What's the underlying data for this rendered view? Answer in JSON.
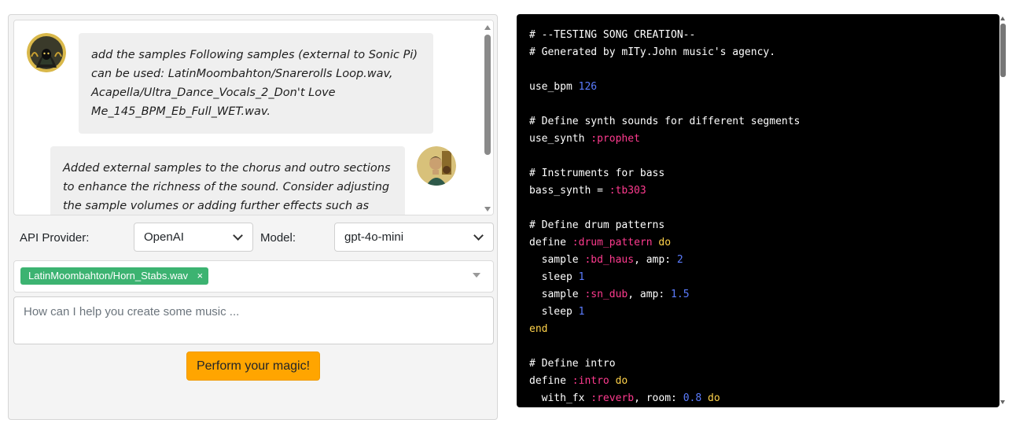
{
  "chat": {
    "messages": [
      {
        "role": "user",
        "avatar": "hooded-figure-avatar",
        "text": "add the samples Following samples (external to Sonic Pi) can be used: LatinMoombahton/Snarerolls Loop.wav, Acapella/Ultra_Dance_Vocals_2_Don't Love Me_145_BPM_Eb_Full_WET.wav."
      },
      {
        "role": "assistant",
        "avatar": "musician-avatar",
        "text": "Added external samples to the chorus and outro sections to enhance the richness of the sound. Consider adjusting the sample volumes or adding further effects such as echo or"
      }
    ]
  },
  "settings": {
    "provider_label": "API Provider:",
    "provider_value": "OpenAI",
    "model_label": "Model:",
    "model_value": "gpt-4o-mini"
  },
  "samples": {
    "selected_tag": "LatinMoombahton/Horn_Stabs.wav",
    "remove_glyph": "×"
  },
  "prompt": {
    "placeholder": "How can I help you create some music ..."
  },
  "actions": {
    "submit_label": "Perform your magic!"
  },
  "colors": {
    "tag_green": "#3cb371",
    "button_orange": "#ffa500",
    "code_background": "#000000",
    "code_number": "#5b7cff",
    "code_symbol": "#ff3b8f",
    "code_keyword": "#ffd24a"
  },
  "code": {
    "lines": [
      [
        {
          "t": "# --TESTING SONG CREATION--",
          "c": "comment"
        }
      ],
      [
        {
          "t": "# Generated by mITy.John music's agency.",
          "c": "comment"
        }
      ],
      [],
      [
        {
          "t": "use_bpm ",
          "c": "plain"
        },
        {
          "t": "126",
          "c": "num"
        }
      ],
      [],
      [
        {
          "t": "# Define synth sounds for different segments",
          "c": "comment"
        }
      ],
      [
        {
          "t": "use_synth ",
          "c": "plain"
        },
        {
          "t": ":prophet",
          "c": "sym"
        }
      ],
      [],
      [
        {
          "t": "# Instruments for bass",
          "c": "comment"
        }
      ],
      [
        {
          "t": "bass_synth = ",
          "c": "plain"
        },
        {
          "t": ":tb303",
          "c": "sym"
        }
      ],
      [],
      [
        {
          "t": "# Define drum patterns",
          "c": "comment"
        }
      ],
      [
        {
          "t": "define ",
          "c": "plain"
        },
        {
          "t": ":drum_pattern",
          "c": "sym"
        },
        {
          "t": " do",
          "c": "kw"
        }
      ],
      [
        {
          "t": "  sample ",
          "c": "plain"
        },
        {
          "t": ":bd_haus",
          "c": "sym"
        },
        {
          "t": ", amp: ",
          "c": "plain"
        },
        {
          "t": "2",
          "c": "num"
        }
      ],
      [
        {
          "t": "  sleep ",
          "c": "plain"
        },
        {
          "t": "1",
          "c": "num"
        }
      ],
      [
        {
          "t": "  sample ",
          "c": "plain"
        },
        {
          "t": ":sn_dub",
          "c": "sym"
        },
        {
          "t": ", amp: ",
          "c": "plain"
        },
        {
          "t": "1.5",
          "c": "num"
        }
      ],
      [
        {
          "t": "  sleep ",
          "c": "plain"
        },
        {
          "t": "1",
          "c": "num"
        }
      ],
      [
        {
          "t": "end",
          "c": "kw"
        }
      ],
      [],
      [
        {
          "t": "# Define intro",
          "c": "comment"
        }
      ],
      [
        {
          "t": "define ",
          "c": "plain"
        },
        {
          "t": ":intro",
          "c": "sym"
        },
        {
          "t": " do",
          "c": "kw"
        }
      ],
      [
        {
          "t": "  with_fx ",
          "c": "plain"
        },
        {
          "t": ":reverb",
          "c": "sym"
        },
        {
          "t": ", room: ",
          "c": "plain"
        },
        {
          "t": "0.8",
          "c": "num"
        },
        {
          "t": " do",
          "c": "kw"
        }
      ]
    ]
  }
}
